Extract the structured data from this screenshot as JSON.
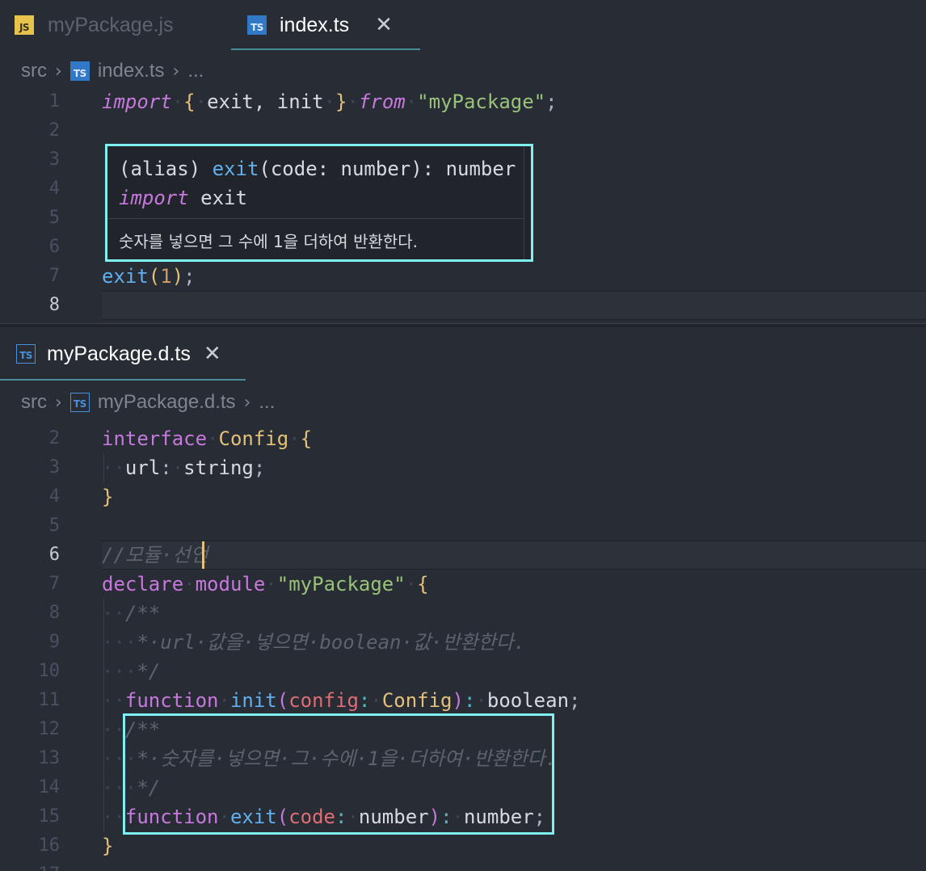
{
  "top_pane": {
    "tabs": [
      {
        "icon": "JS",
        "label": "myPackage.js",
        "active": false
      },
      {
        "icon": "TS",
        "label": "index.ts",
        "active": true,
        "close": "✕"
      }
    ],
    "breadcrumb": {
      "folder": "src",
      "sep": "›",
      "icon": "TS",
      "file": "index.ts",
      "more": "..."
    },
    "line_numbers": [
      "1",
      "2",
      "3",
      "4",
      "5",
      "6",
      "7",
      "8"
    ],
    "current_line": "8",
    "line1": {
      "import": "import",
      "open": "{",
      "names": "exit, init",
      "close": "}",
      "from": "from",
      "module": "\"myPackage\"",
      "semi": ";"
    },
    "line7": {
      "fn": "exit",
      "open": "(",
      "arg": "1",
      "close": ")",
      "semi": ";"
    },
    "hover": {
      "alias": "(alias) ",
      "fn": "exit",
      "sig_rest": "(code: number): number",
      "import_kw": "import",
      "import_name": " exit",
      "doc": "숫자를 넣으면 그 수에 1을 더하여 반환한다."
    }
  },
  "bottom_pane": {
    "tab": {
      "icon": "TS",
      "label": "myPackage.d.ts",
      "close": "✕"
    },
    "breadcrumb": {
      "folder": "src",
      "sep": "›",
      "icon": "TS",
      "file": "myPackage.d.ts",
      "more": "..."
    },
    "line_numbers": [
      "2",
      "3",
      "4",
      "5",
      "6",
      "7",
      "8",
      "9",
      "10",
      "11",
      "12",
      "13",
      "14",
      "15",
      "16",
      "17"
    ],
    "current_line": "6",
    "code": {
      "l2": {
        "kw": "interface",
        "name": "Config",
        "brace": "{"
      },
      "l3": {
        "prop": "url",
        "colon": ":",
        "type": "string",
        "semi": ";"
      },
      "l4": {
        "brace": "}"
      },
      "l6": {
        "comment": "//모듈·선언"
      },
      "l7": {
        "kw1": "declare",
        "kw2": "module",
        "str": "\"myPackage\"",
        "brace": "{"
      },
      "l8": {
        "comment": "/**"
      },
      "l9": {
        "comment": "*·url·값을·넣으면·boolean·값·반환한다."
      },
      "l10": {
        "comment": "*/"
      },
      "l11": {
        "kw": "function",
        "fn": "init",
        "open": "(",
        "param": "config",
        "colon": ":",
        "type": "Config",
        "close": ")",
        "colon2": ":",
        "ret": "boolean",
        "semi": ";"
      },
      "l12": {
        "comment": "/**"
      },
      "l13": {
        "comment": "*·숫자를·넣으면·그·수에·1을·더하여·반환한다."
      },
      "l14": {
        "comment": "*/"
      },
      "l15": {
        "kw": "function",
        "fn": "exit",
        "open": "(",
        "param": "code",
        "colon": ":",
        "type": "number",
        "close": ")",
        "colon2": ":",
        "ret": "number",
        "semi": ";"
      },
      "l16": {
        "brace": "}"
      }
    }
  },
  "colors": {
    "highlight_box": "#7ff0f0",
    "background": "#282c34",
    "keyword": "#c678dd",
    "function": "#61afef",
    "string": "#98c379",
    "type": "#e5c07b"
  }
}
